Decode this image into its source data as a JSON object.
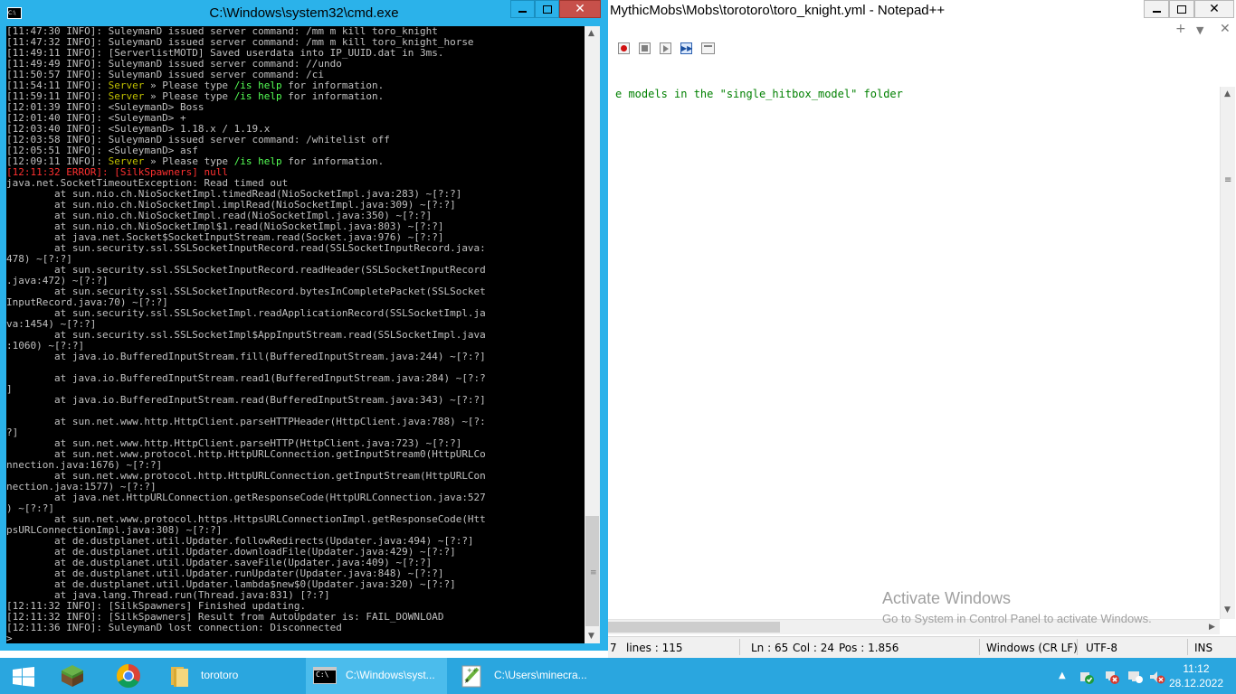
{
  "notepad": {
    "title": "MythicMobs\\Mobs\\torotoro\\toro_knight.yml - Notepad++",
    "tab_add": "+",
    "tab_list": "▼",
    "tab_close": "✕",
    "code_line": "e models in the \"single_hitbox_model\" folder",
    "status": {
      "length_fragment": "7",
      "lines": "lines : 115",
      "ln": "Ln : 65",
      "col": "Col : 24",
      "pos": "Pos : 1.856",
      "eol": "Windows (CR LF)",
      "encoding": "UTF-8",
      "mode": "INS"
    }
  },
  "activate": {
    "heading": "Activate Windows",
    "sub": "Go to System in Control Panel to activate Windows."
  },
  "cmd": {
    "title": "C:\\Windows\\system32\\cmd.exe",
    "icon_text": "C:\\",
    "lines": [
      "[11:47:30 INFO]: SuleymanD issued server command: /mm m kill toro_knight",
      "[11:47:32 INFO]: SuleymanD issued server command: /mm m kill toro_knight_horse",
      "[11:49:11 INFO]: [ServerlistMOTD] Saved userdata into IP_UUID.dat in 3ms.",
      "[11:49:49 INFO]: SuleymanD issued server command: //undo",
      "[11:50:57 INFO]: SuleymanD issued server command: /ci",
      "[11:54:11 INFO]: Server » Please type /is help for information.",
      "[11:59:11 INFO]: Server » Please type /is help for information.",
      "[12:01:39 INFO]: <SuleymanD> Boss",
      "[12:01:40 INFO]: <SuleymanD> +",
      "[12:03:40 INFO]: <SuleymanD> 1.18.x / 1.19.x",
      "[12:03:58 INFO]: SuleymanD issued server command: /whitelist off",
      "[12:05:51 INFO]: <SuleymanD> asf",
      "[12:09:11 INFO]: Server » Please type /is help for information.",
      "[12:11:32 ERROR]: [SilkSpawners] null",
      "java.net.SocketTimeoutException: Read timed out",
      "        at sun.nio.ch.NioSocketImpl.timedRead(NioSocketImpl.java:283) ~[?:?]",
      "        at sun.nio.ch.NioSocketImpl.implRead(NioSocketImpl.java:309) ~[?:?]",
      "        at sun.nio.ch.NioSocketImpl.read(NioSocketImpl.java:350) ~[?:?]",
      "        at sun.nio.ch.NioSocketImpl$1.read(NioSocketImpl.java:803) ~[?:?]",
      "        at java.net.Socket$SocketInputStream.read(Socket.java:976) ~[?:?]",
      "        at sun.security.ssl.SSLSocketInputRecord.read(SSLSocketInputRecord.java:",
      "478) ~[?:?]",
      "        at sun.security.ssl.SSLSocketInputRecord.readHeader(SSLSocketInputRecord",
      ".java:472) ~[?:?]",
      "        at sun.security.ssl.SSLSocketInputRecord.bytesInCompletePacket(SSLSocket",
      "InputRecord.java:70) ~[?:?]",
      "        at sun.security.ssl.SSLSocketImpl.readApplicationRecord(SSLSocketImpl.ja",
      "va:1454) ~[?:?]",
      "        at sun.security.ssl.SSLSocketImpl$AppInputStream.read(SSLSocketImpl.java",
      ":1060) ~[?:?]",
      "        at java.io.BufferedInputStream.fill(BufferedInputStream.java:244) ~[?:?]",
      "",
      "        at java.io.BufferedInputStream.read1(BufferedInputStream.java:284) ~[?:?",
      "]",
      "        at java.io.BufferedInputStream.read(BufferedInputStream.java:343) ~[?:?]",
      "",
      "        at sun.net.www.http.HttpClient.parseHTTPHeader(HttpClient.java:788) ~[?:",
      "?]",
      "        at sun.net.www.http.HttpClient.parseHTTP(HttpClient.java:723) ~[?:?]",
      "        at sun.net.www.protocol.http.HttpURLConnection.getInputStream0(HttpURLCo",
      "nnection.java:1676) ~[?:?]",
      "        at sun.net.www.protocol.http.HttpURLConnection.getInputStream(HttpURLCon",
      "nection.java:1577) ~[?:?]",
      "        at java.net.HttpURLConnection.getResponseCode(HttpURLConnection.java:527",
      ") ~[?:?]",
      "        at sun.net.www.protocol.https.HttpsURLConnectionImpl.getResponseCode(Htt",
      "psURLConnectionImpl.java:308) ~[?:?]",
      "        at de.dustplanet.util.Updater.followRedirects(Updater.java:494) ~[?:?]",
      "        at de.dustplanet.util.Updater.downloadFile(Updater.java:429) ~[?:?]",
      "        at de.dustplanet.util.Updater.saveFile(Updater.java:409) ~[?:?]",
      "        at de.dustplanet.util.Updater.runUpdater(Updater.java:848) ~[?:?]",
      "        at de.dustplanet.util.Updater.lambda$new$0(Updater.java:320) ~[?:?]",
      "        at java.lang.Thread.run(Thread.java:831) [?:?]",
      "[12:11:32 INFO]: [SilkSpawners] Finished updating.",
      "[12:11:32 INFO]: [SilkSpawners] Result from AutoUpdater is: FAIL_DOWNLOAD",
      "[12:11:36 INFO]: SuleymanD lost connection: Disconnected",
      "> _"
    ],
    "error_line_index": 13,
    "server_line_indices": [
      5,
      6,
      12
    ]
  },
  "taskbar": {
    "items": [
      {
        "label": "torotoro",
        "icon": "folder-icon"
      },
      {
        "label": "C:\\Windows\\syst...",
        "icon": "cmd-icon"
      },
      {
        "label": "C:\\Users\\minecra...",
        "icon": "notepadpp-icon"
      }
    ],
    "tray_caret": "▲",
    "time": "11:12",
    "date": "28.12.2022"
  },
  "colors": {
    "cmd_border": "#2bb2ea",
    "taskbar": "#2aa6df",
    "error_text": "#ff3030",
    "server_text": "#c0c000",
    "command_highlight": "#55ff55"
  }
}
